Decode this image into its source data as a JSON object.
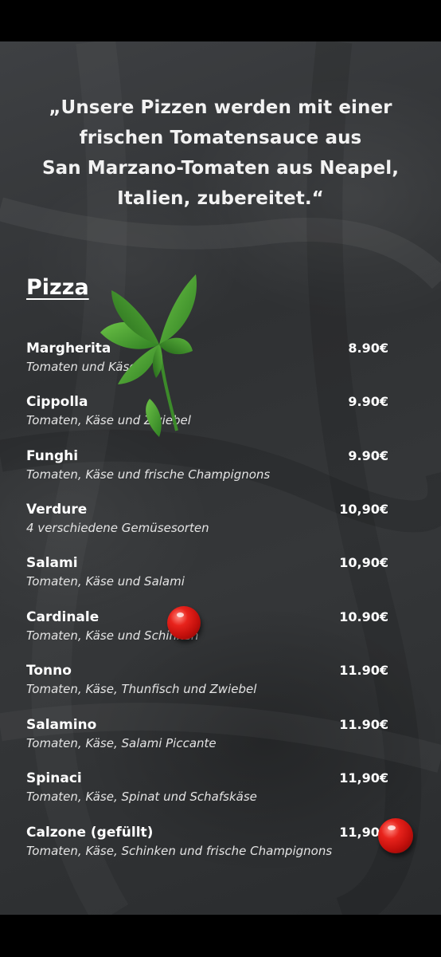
{
  "quote": "„Unsere Pizzen werden mit einer\nfrischen Tomatensauce aus\nSan Marzano-Tomaten aus Neapel,\nItalien, zubereitet.“",
  "section": {
    "title": "Pizza"
  },
  "items": [
    {
      "name": "Margherita",
      "price": "8.90€",
      "desc": "Tomaten und Käse"
    },
    {
      "name": "Cippolla",
      "price": "9.90€",
      "desc": "Tomaten, Käse und Zwiebel"
    },
    {
      "name": "Funghi",
      "price": "9.90€",
      "desc": "Tomaten, Käse und frische Champignons"
    },
    {
      "name": "Verdure",
      "price": "10,90€",
      "desc": "4 verschiedene Gemüsesorten"
    },
    {
      "name": "Salami",
      "price": "10,90€",
      "desc": "Tomaten, Käse und Salami"
    },
    {
      "name": "Cardinale",
      "price": "10.90€",
      "desc": "Tomaten, Käse und Schinken"
    },
    {
      "name": "Tonno",
      "price": "11.90€",
      "desc": "Tomaten, Käse, Thunfisch und Zwiebel"
    },
    {
      "name": "Salamino",
      "price": "11.90€",
      "desc": "Tomaten, Käse, Salami  Piccante"
    },
    {
      "name": "Spinaci",
      "price": "11,90€",
      "desc": "Tomaten, Käse, Spinat und Schafskäse"
    },
    {
      "name": "Calzone (gefüllt)",
      "price": "11,90€",
      "desc": "Tomaten, Käse, Schinken und frische Champignons"
    }
  ],
  "colors": {
    "background": "#333537",
    "text": "#ffffff",
    "tomato": "#d8140f",
    "basil": "#3f9a2e"
  },
  "icons": [
    "basil-leaf-icon",
    "cherry-tomato-icon"
  ]
}
